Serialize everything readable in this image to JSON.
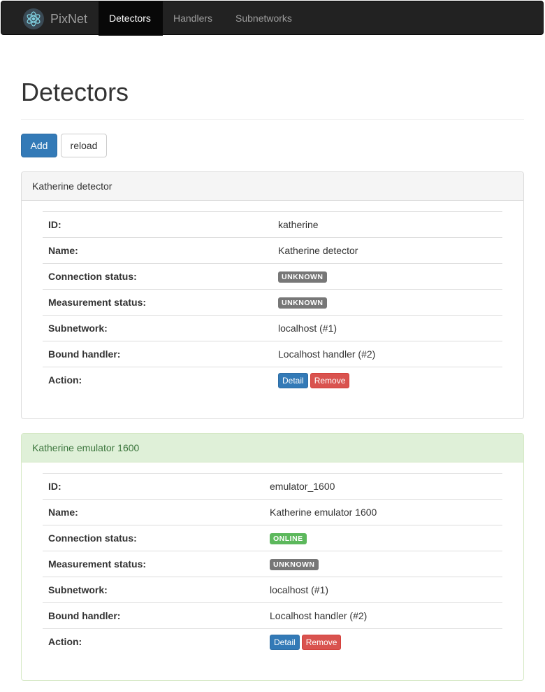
{
  "navbar": {
    "brand": "PixNet",
    "tabs": [
      "Detectors",
      "Handlers",
      "Subnetworks"
    ],
    "active_tab": "Detectors"
  },
  "page": {
    "title": "Detectors",
    "add_label": "Add",
    "reload_label": "reload"
  },
  "labels": {
    "id": "ID:",
    "name": "Name:",
    "connection_status": "Connection status:",
    "measurement_status": "Measurement status:",
    "subnetwork": "Subnetwork:",
    "bound_handler": "Bound handler:",
    "action": "Action:"
  },
  "actions": {
    "detail": "Detail",
    "remove": "Remove"
  },
  "colors": {
    "primary": "#337ab7",
    "danger": "#d9534f",
    "success": "#5cb85c",
    "badge_default": "#777777",
    "panel_success_bg": "#dff0d8"
  },
  "detectors": [
    {
      "heading": "Katherine detector",
      "id": "katherine",
      "name": "Katherine detector",
      "connection_status": "UNKNOWN",
      "measurement_status": "UNKNOWN",
      "subnetwork": "localhost (#1)",
      "bound_handler": "Localhost handler (#2)"
    },
    {
      "heading": "Katherine emulator 1600",
      "id": "emulator_1600",
      "name": "Katherine emulator 1600",
      "connection_status": "ONLINE",
      "measurement_status": "UNKNOWN",
      "subnetwork": "localhost (#1)",
      "bound_handler": "Localhost handler (#2)"
    }
  ]
}
